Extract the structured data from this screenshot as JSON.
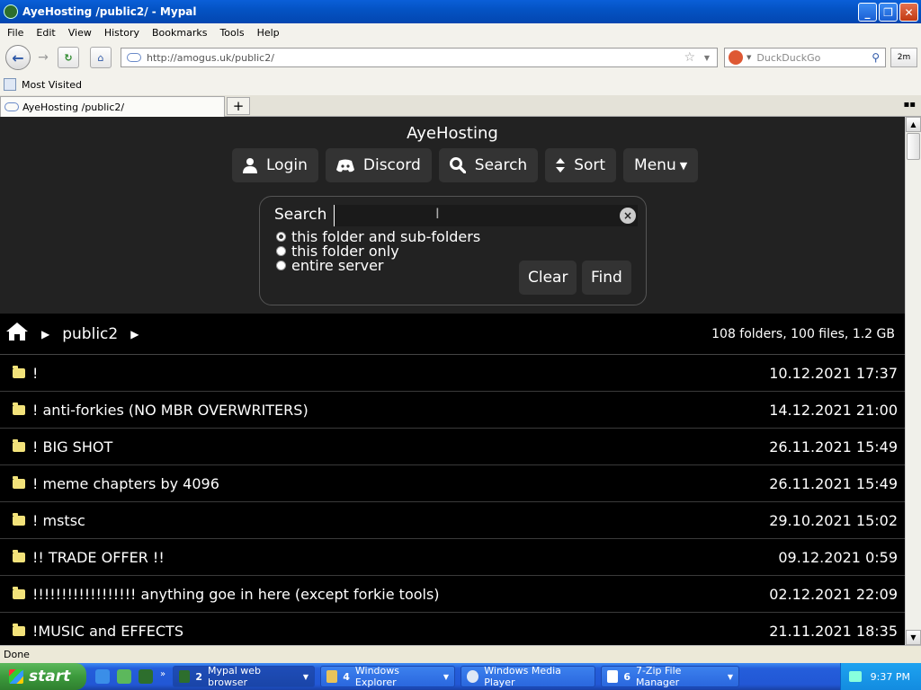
{
  "window": {
    "title": "AyeHosting /public2/ - Mypal"
  },
  "menubar": [
    "File",
    "Edit",
    "View",
    "History",
    "Bookmarks",
    "Tools",
    "Help"
  ],
  "navbar": {
    "url": "http://amogus.uk/public2/",
    "search_placeholder": "DuckDuckGo",
    "ext_label": "2m"
  },
  "bookmarks": {
    "most_visited": "Most Visited"
  },
  "tab": {
    "title": "AyeHosting /public2/",
    "new_tab": "+"
  },
  "site": {
    "title": "AyeHosting",
    "buttons": {
      "login": "Login",
      "discord": "Discord",
      "search": "Search",
      "sort": "Sort",
      "menu": "Menu"
    },
    "search": {
      "label": "Search",
      "value": "",
      "options": [
        "this folder and sub-folders",
        "this folder only",
        "entire server"
      ],
      "selected_option": "this folder and sub-folders",
      "clear": "Clear",
      "find": "Find"
    },
    "path": {
      "folder": "public2",
      "stats": "108 folders, 100 files, 1.2 GB"
    },
    "rows": [
      {
        "name": "!",
        "date": "10.12.2021 17:37"
      },
      {
        "name": "! anti-forkies (NO MBR OVERWRITERS)",
        "date": "14.12.2021 21:00"
      },
      {
        "name": "! BIG SHOT",
        "date": "26.11.2021 15:49"
      },
      {
        "name": "! meme chapters by 4096",
        "date": "26.11.2021 15:49"
      },
      {
        "name": "! mstsc",
        "date": "29.10.2021 15:02"
      },
      {
        "name": "!! TRADE OFFER !!",
        "date": "09.12.2021 0:59"
      },
      {
        "name": "!!!!!!!!!!!!!!!!!! anything goe in here (except forkie tools)",
        "date": "02.12.2021 22:09"
      },
      {
        "name": "!MUSIC and EFFECTS",
        "date": "21.11.2021 18:35"
      }
    ]
  },
  "status": {
    "text": "Done"
  },
  "taskbar": {
    "start": "start",
    "tasks": [
      {
        "count": "2",
        "label": "Mypal web browser"
      },
      {
        "count": "4",
        "label": "Windows Explorer"
      },
      {
        "count": "",
        "label": "Windows Media Player"
      },
      {
        "count": "6",
        "label": "7-Zip File Manager"
      }
    ],
    "clock": "9:37 PM"
  },
  "colors": {
    "page_background": "#000000",
    "header_background": "#222222",
    "button_background": "#333333",
    "folder_icon": "#f2e27a",
    "xp_blue": "#245edb",
    "start_green": "#3c9a3c"
  }
}
